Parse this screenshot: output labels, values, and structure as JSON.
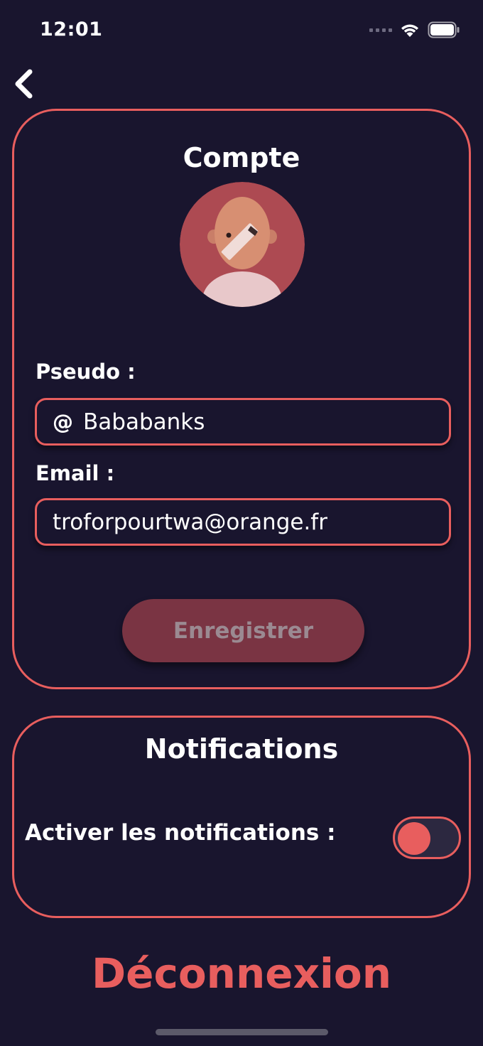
{
  "status_bar": {
    "time": "12:01"
  },
  "account": {
    "title": "Compte",
    "pseudo_label": "Pseudo :",
    "pseudo_prefix": "@",
    "pseudo_value": "Bababanks",
    "email_label": "Email :",
    "email_value": "troforpourtwa@orange.fr",
    "save_label": "Enregistrer"
  },
  "notifications": {
    "title": "Notifications",
    "toggle_label": "Activer les notifications :",
    "enabled": false
  },
  "logout_label": "Déconnexion",
  "colors": {
    "background": "#19152e",
    "accent": "#e85e5e",
    "button_disabled": "#7a3443"
  },
  "icons": [
    "back-chevron-icon",
    "signal-icon",
    "wifi-icon",
    "battery-icon",
    "edit-pencil-icon"
  ]
}
